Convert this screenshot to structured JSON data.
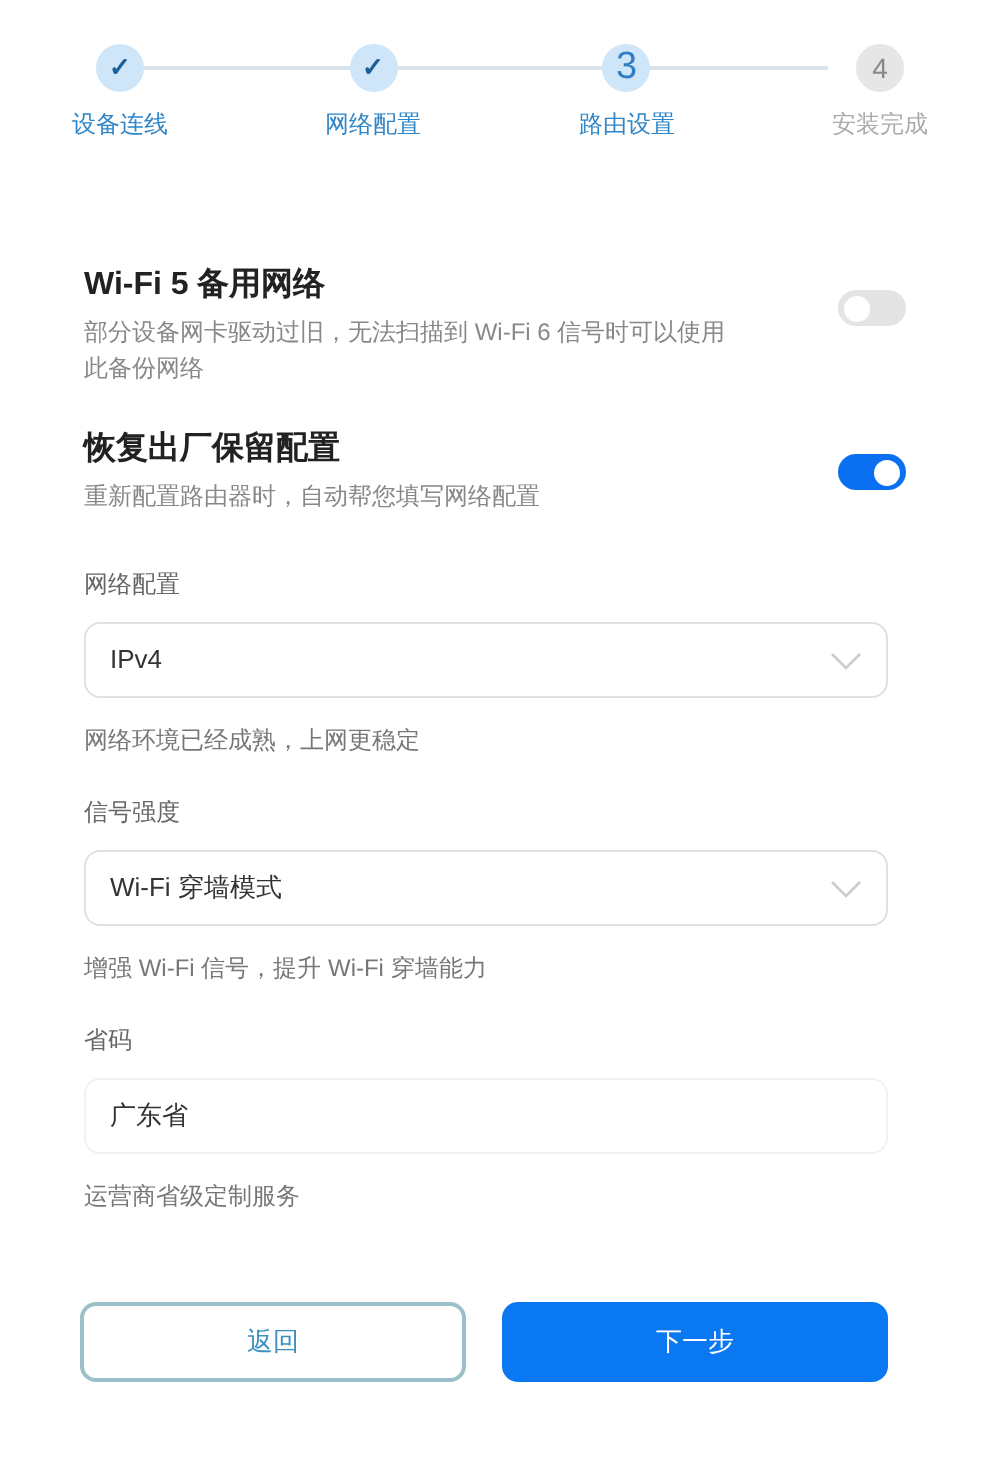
{
  "steps": [
    {
      "marker": "✓",
      "kind": "done",
      "label": "设备连线"
    },
    {
      "marker": "✓",
      "kind": "done",
      "label": "网络配置"
    },
    {
      "marker": "3",
      "kind": "current",
      "label": "路由设置"
    },
    {
      "marker": "4",
      "kind": "pending",
      "label": "安装完成"
    }
  ],
  "toggles": [
    {
      "title": "Wi-Fi 5 备用网络",
      "description": "部分设备网卡驱动过旧，无法扫描到 Wi-Fi 6 信号时可以使用此备份网络",
      "on": false
    },
    {
      "title": "恢复出厂保留配置",
      "description": "重新配置路由器时，自动帮您填写网络配置",
      "on": true
    }
  ],
  "fields": [
    {
      "kind": "select",
      "label": "网络配置",
      "value": "IPv4",
      "hint": "网络环境已经成熟，上网更稳定"
    },
    {
      "kind": "select",
      "label": "信号强度",
      "value": "Wi-Fi 穿墙模式",
      "hint": "增强 Wi-Fi 信号，提升 Wi-Fi 穿墙能力"
    },
    {
      "kind": "text",
      "label": "省码",
      "value": "广东省",
      "hint": "运营商省级定制服务"
    }
  ],
  "buttons": [
    {
      "label": "返回",
      "kind": "secondary"
    },
    {
      "label": "下一步",
      "kind": "primary"
    }
  ]
}
